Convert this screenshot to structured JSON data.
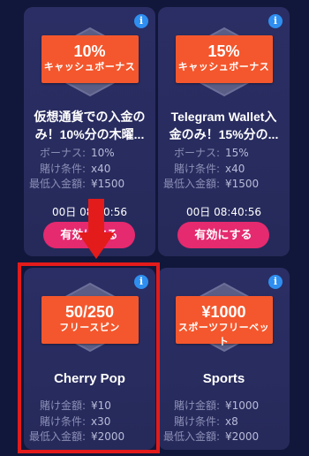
{
  "cards": [
    {
      "info_glyph": "i",
      "badge_big": "10%",
      "badge_small": "キャッシュボーナス",
      "title_line1": "仮想通貨での入金の",
      "title_line2": "み！10%分の木曜...",
      "rows": [
        {
          "k": "ボーナス:",
          "v": "10%"
        },
        {
          "k": "賭け条件:",
          "v": "x40"
        },
        {
          "k": "最低入金額:",
          "v": "¥1500"
        }
      ],
      "timer": "00日 08:40:56",
      "cta": "有効にする"
    },
    {
      "info_glyph": "i",
      "badge_big": "15%",
      "badge_small": "キャッシュボーナス",
      "title_line1": "Telegram Wallet入",
      "title_line2": "金のみ！15%分の...",
      "rows": [
        {
          "k": "ボーナス:",
          "v": "15%"
        },
        {
          "k": "賭け条件:",
          "v": "x40"
        },
        {
          "k": "最低入金額:",
          "v": "¥1500"
        }
      ],
      "timer": "00日 08:40:56",
      "cta": "有効にする"
    },
    {
      "info_glyph": "i",
      "badge_big": "50/250",
      "badge_small": "フリースピン",
      "title": "Cherry Pop",
      "rows": [
        {
          "k": "賭け金額:",
          "v": "¥10"
        },
        {
          "k": "賭け条件:",
          "v": "x30"
        },
        {
          "k": "最低入金額:",
          "v": "¥2000"
        }
      ]
    },
    {
      "info_glyph": "i",
      "badge_big": "¥1000",
      "badge_small": "スポーツフリーベット",
      "title": "Sports",
      "rows": [
        {
          "k": "賭け金額:",
          "v": "¥1000"
        },
        {
          "k": "賭け条件:",
          "v": "x8"
        },
        {
          "k": "最低入金額:",
          "v": "¥2000"
        }
      ]
    }
  ],
  "colors": {
    "background": "#11173a",
    "card": "#2b2e64",
    "badge": "#f4572d",
    "cta": "#e52a6f",
    "info": "#2f8ff0",
    "highlight": "#e31b1b"
  }
}
